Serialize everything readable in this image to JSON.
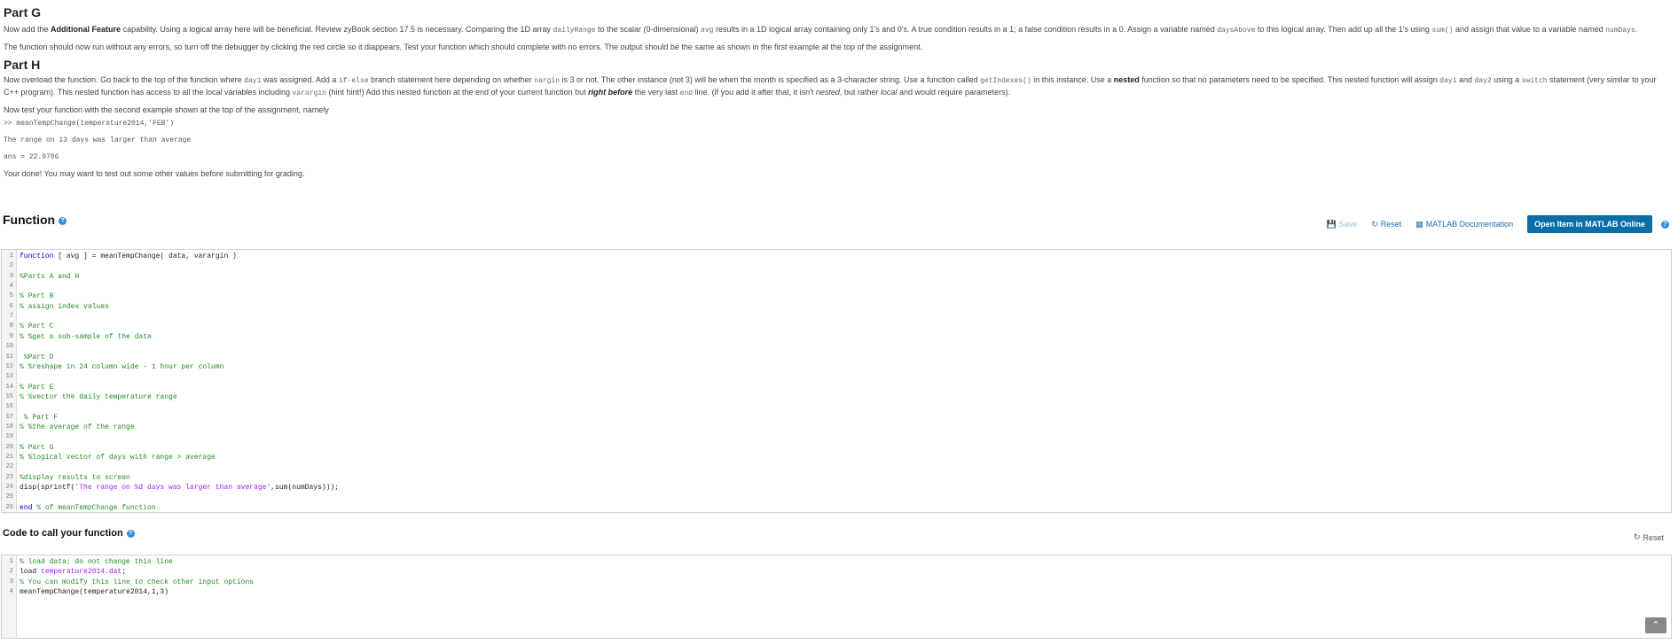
{
  "partG": {
    "title": "Part G",
    "p1_a": "Now add the ",
    "p1_b": "Additional Feature",
    "p1_c": " capability. Using a logical array here will be beneficial. Review zyBook section 17.5 is necessary. Comparing the 1D array ",
    "p1_code1": "dailyRange",
    "p1_d": " to the scalar (0-dimensional) ",
    "p1_code2": "avg",
    "p1_e": " results in a 1D logical array containing only 1's and 0's. A true condition results in a 1; a false condition results in a 0. Assign a variable named ",
    "p1_code3": "daysAbove",
    "p1_f": " to this logical array.  Then add up all the 1's using ",
    "p1_code4": "sum()",
    "p1_g": " and assign that value to a variable named ",
    "p1_code5": "numDays",
    "p1_h": ".",
    "p2": "The function should now run without any errors, so turn off the debugger by clicking the red circle so it diappears. Test your function which should complete with no errors. The output should be the same as shown in the first example at the top of the assignment."
  },
  "partH": {
    "title": "Part H",
    "p1_a": "Now overload the function. Go back to the top of the function where ",
    "p1_code1": "day1",
    "p1_b": " was assigned. Add a ",
    "p1_code2": "if-else",
    "p1_c": " branch statement here depending on whether ",
    "p1_code3": "nargin",
    "p1_d": " is 3 or not. The other instance (not 3) will be when the month is specified as a 3-character string. Use a function called ",
    "p1_code4": "getIndexes()",
    "p1_e": " in this instance.  Use a ",
    "p1_bold1": "nested",
    "p1_f": " function so that no parameters need to be specified. This nested function will assign ",
    "p1_code5": "day1",
    "p1_g": " and ",
    "p1_code6": "day2",
    "p1_h": " using a ",
    "p1_code7": "switch",
    "p1_i": " statement (very similar to your C++ program). This nested function has access to all the local variables including ",
    "p1_code8": "varargin",
    "p1_j": " (hint hint!)  Add this nested function at the end of your current function but ",
    "p1_bold2": "right before",
    "p1_k": " the very last ",
    "p1_code9": "end",
    "p1_l": " line. (if you add it after that, it isn't ",
    "p1_it1": "nested",
    "p1_m": ", but rather ",
    "p1_it2": "local",
    "p1_n": " and would require parameters).",
    "p2": "Now test your function with the second example shown at the top of the assignment, namely",
    "code1": ">> meanTempChange(temperature2014,'FEB')",
    "code2": "The range on 13 days was larger than average",
    "code3": "ans =  22.9786",
    "p3": "Your done! You may want to test out some other values before submitting for grading."
  },
  "function_section": {
    "title": "Function",
    "save": "Save",
    "reset": "Reset",
    "docs": "MATLAB Documentation",
    "open": "Open Item in MATLAB Online"
  },
  "editor1": {
    "lines": [
      {
        "n": "1",
        "t": "function [ avg ] = meanTempChange( data, varargin )",
        "k": "fn"
      },
      {
        "n": "2",
        "t": "",
        "k": "plain"
      },
      {
        "n": "3",
        "t": "%Parts A and H",
        "k": "comment"
      },
      {
        "n": "4",
        "t": "",
        "k": "plain"
      },
      {
        "n": "5",
        "t": "% Part B",
        "k": "comment"
      },
      {
        "n": "6",
        "t": "% assign index values",
        "k": "comment"
      },
      {
        "n": "7",
        "t": "",
        "k": "plain"
      },
      {
        "n": "8",
        "t": "% Part C",
        "k": "comment"
      },
      {
        "n": "9",
        "t": "% %get a sub-sample of the data",
        "k": "comment"
      },
      {
        "n": "10",
        "t": "",
        "k": "plain"
      },
      {
        "n": "11",
        "t": " %Part D",
        "k": "comment"
      },
      {
        "n": "12",
        "t": "% %reshape in 24 column wide - 1 hour per column",
        "k": "comment"
      },
      {
        "n": "13",
        "t": "",
        "k": "plain"
      },
      {
        "n": "14",
        "t": "% Part E",
        "k": "comment"
      },
      {
        "n": "15",
        "t": "% %vector the daily temperature range",
        "k": "comment"
      },
      {
        "n": "16",
        "t": "",
        "k": "plain"
      },
      {
        "n": "17",
        "t": " % Part F",
        "k": "comment"
      },
      {
        "n": "18",
        "t": "% %the average of the range",
        "k": "comment"
      },
      {
        "n": "19",
        "t": "",
        "k": "plain"
      },
      {
        "n": "20",
        "t": "% Part G",
        "k": "comment"
      },
      {
        "n": "21",
        "t": "% %logical vector of days with range > average",
        "k": "comment"
      },
      {
        "n": "22",
        "t": "",
        "k": "plain"
      },
      {
        "n": "23",
        "t": "%display results to screen",
        "k": "comment"
      },
      {
        "n": "24",
        "t": "disp(sprintf('The range on %d days was larger than average',sum(numDays)));",
        "k": "disp"
      },
      {
        "n": "25",
        "t": "",
        "k": "plain"
      },
      {
        "n": "26",
        "t": "end % of meanTempChange function",
        "k": "end"
      }
    ]
  },
  "call_section": {
    "title": "Code to call your function",
    "reset": "Reset"
  },
  "editor2": {
    "lines": [
      {
        "n": "1",
        "t": "% load data; do not change this line",
        "k": "comment"
      },
      {
        "n": "2",
        "t": "load temperature2014.dat;",
        "k": "load"
      },
      {
        "n": "3",
        "t": "% You can modify this line to check other input options",
        "k": "comment"
      },
      {
        "n": "4",
        "t": "meanTempChange(temperature2014,1,3)",
        "k": "plain"
      }
    ]
  },
  "icons": {
    "save": "save-icon",
    "reset": "reset-icon",
    "docs": "documentation-icon",
    "help": "help-icon",
    "scroll": "chevron-up-icon"
  },
  "colors": {
    "primary": "#0a6ea8",
    "link": "#1b6fa8",
    "comment": "#228b22",
    "keyword": "#0000cc",
    "string": "#a020f0"
  }
}
